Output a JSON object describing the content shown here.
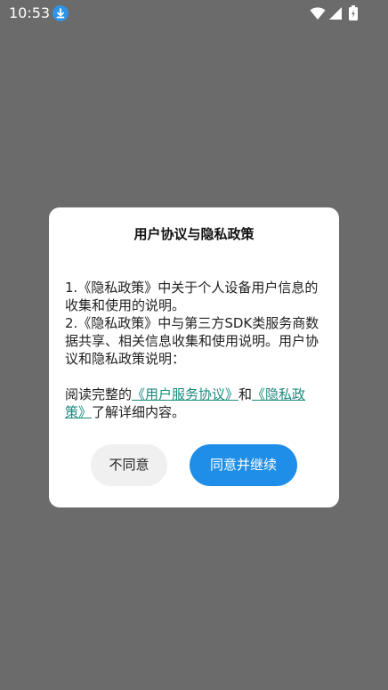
{
  "status_bar": {
    "time": "10:53",
    "icons": [
      "download-icon",
      "wifi-icon",
      "signal-icon",
      "battery-icon"
    ]
  },
  "dialog": {
    "title": "用户协议与隐私政策",
    "item1": "1.《隐私政策》中关于个人设备用户信息的收集和使用的说明。",
    "item2": "2.《隐私政策》中与第三方SDK类服务商数据共享、相关信息收集和使用说明。用户协议和隐私政策说明：",
    "read_prefix": "阅读完整的",
    "link_user_agreement": "《用户服务协议》",
    "read_and": "和",
    "link_privacy_policy": "《隐私政策》",
    "read_suffix": "了解详细内容。",
    "disagree_label": "不同意",
    "agree_label": "同意并继续"
  },
  "colors": {
    "overlay": "#6b6b6b",
    "link": "#1a8a7d",
    "primary_button": "#1f8ee8",
    "secondary_button": "#f0f0f0",
    "download_badge": "#2f93e6"
  }
}
